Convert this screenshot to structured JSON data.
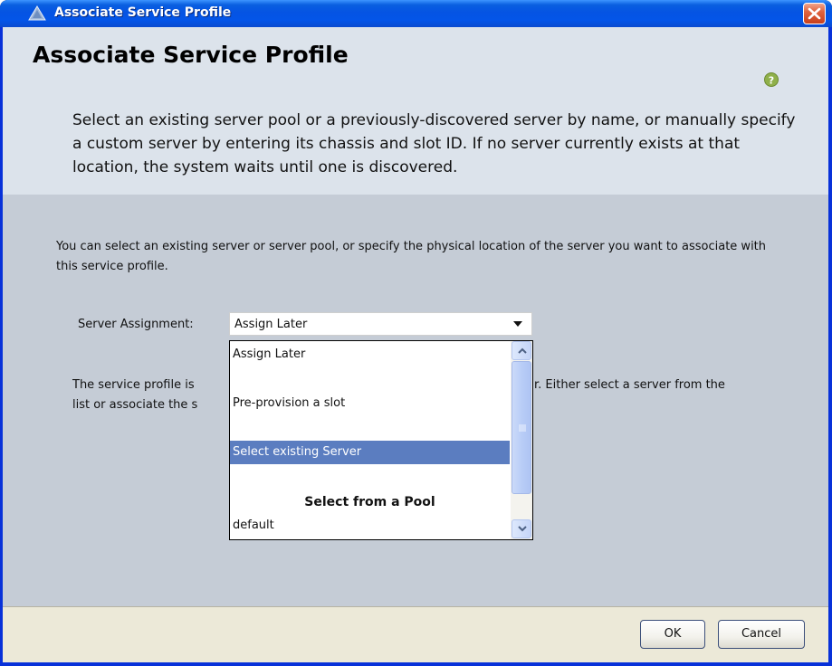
{
  "window": {
    "title": "Associate Service Profile",
    "icon": "warning-triangle-icon"
  },
  "header": {
    "title": "Associate Service Profile",
    "description": "Select an existing server pool or a previously-discovered server by name, or manually specify a custom server by entering its chassis and slot ID. If no server currently exists at that location, the system waits until one is discovered.",
    "help_icon": "help-icon"
  },
  "content": {
    "intro": "You can select an existing server or server pool, or specify the physical location of the server you want to associate with this service profile.",
    "server_assignment": {
      "label": "Server Assignment:",
      "value": "Assign Later"
    },
    "message_left_1": "The service profile is",
    "message_left_2": "list or associate the s",
    "message_right_1": "r. Either select a server from the"
  },
  "dropdown": {
    "options": [
      {
        "label": "Assign Later",
        "selected": false
      },
      {
        "label": "Pre-provision a slot",
        "selected": false
      },
      {
        "label": "Select existing Server",
        "selected": true
      }
    ],
    "pool_header": "Select from a Pool",
    "pool_options": [
      "default"
    ]
  },
  "footer": {
    "ok_label": "OK",
    "cancel_label": "Cancel"
  },
  "colors": {
    "titlebar": "#0554e3",
    "header_bg": "#dce3eb",
    "content_bg": "#c5ccd6",
    "footer_bg": "#ece9d8",
    "selection": "#5b7dc0"
  }
}
